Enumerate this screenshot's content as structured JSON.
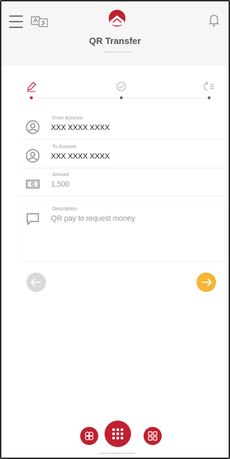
{
  "header": {
    "title": "QR Transfer",
    "menu_icon": "menu-icon",
    "language_icon": "language-toggle-icon",
    "notification_icon": "bell-icon",
    "brand_color": "#c0202f"
  },
  "steps": [
    {
      "icon": "pencil-icon",
      "state": "active"
    },
    {
      "icon": "check-circle-icon",
      "state": "pending"
    },
    {
      "icon": "review-list-icon",
      "state": "pending"
    }
  ],
  "form": {
    "from_account": {
      "label": "From Account",
      "value": "XXX XXXX XXXX",
      "icon": "user-circle-icon"
    },
    "to_account": {
      "label": "To Account",
      "value": "XXX XXXX XXXX",
      "icon": "user-circle-icon"
    },
    "amount": {
      "label": "Amount",
      "value": "1,500",
      "icon": "banknote-icon"
    },
    "description": {
      "label": "Description",
      "value": "QR pay to request money",
      "icon": "comment-icon"
    }
  },
  "navigation": {
    "back_icon": "arrow-left-icon",
    "next_icon": "arrow-right-icon",
    "back_color": "#d9d9d9",
    "next_color": "#f6b535"
  },
  "bottom_bar": {
    "left_icon": "people-icon",
    "center_icon": "grid-dots-icon",
    "right_icon": "qr-code-icon"
  }
}
